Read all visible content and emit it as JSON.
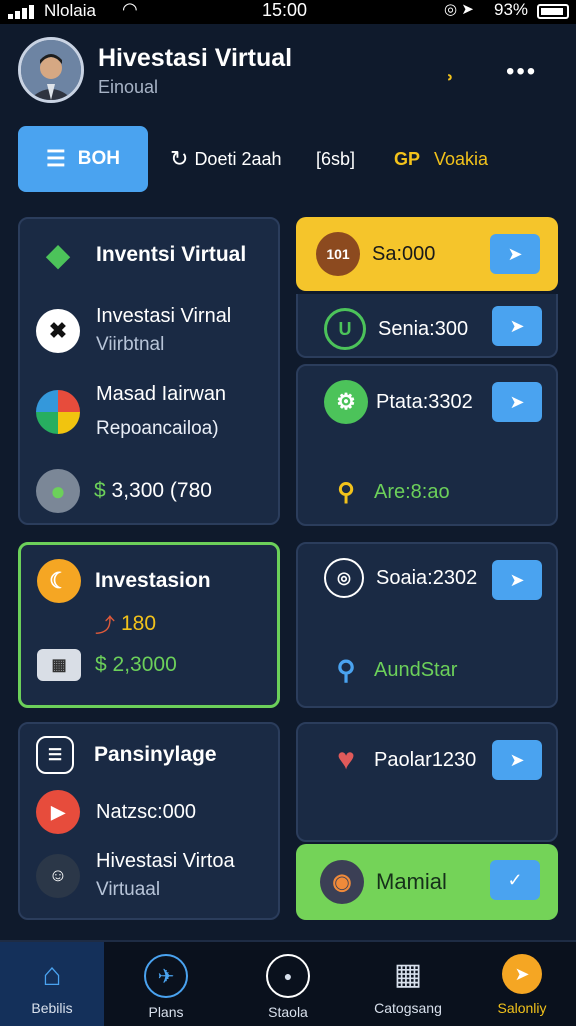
{
  "status_bar": {
    "carrier": "Nlolaia",
    "time": "15:00",
    "battery": "93%"
  },
  "header": {
    "title": "Hivestasi Virtual",
    "subtitle": "Einoual"
  },
  "tabs": [
    {
      "label": "BOH"
    },
    {
      "label": "Doeti 2aah"
    },
    {
      "label": "[6sb]"
    },
    {
      "label": "Voakia"
    }
  ],
  "left_card_1": {
    "title": "Inventsi Virtual",
    "item1_title": "Investasi Virnal",
    "item1_sub": "Viirbtnal",
    "item2_title": "Masad Iairwan",
    "item2_sub": "Repoancailoa)",
    "amount": "3,300 (780"
  },
  "left_card_2": {
    "title": "Investasion",
    "value": "180",
    "amount": "2,3000"
  },
  "left_card_3": {
    "title": "Pansinylage",
    "item1_title": "Natzsc:000",
    "item2_title": "Hivestasi Virtoa",
    "item2_sub": "Virtuaal"
  },
  "right_items": [
    {
      "label": "Sa:000",
      "icon_text": "101"
    },
    {
      "label": "Senia:300"
    },
    {
      "label": "Ptata:3302"
    },
    {
      "label": "Are:8:ao"
    },
    {
      "label": "Soaia:2302"
    },
    {
      "label": "AundStar"
    },
    {
      "label": "Paolar1230"
    },
    {
      "label": "Mamial"
    }
  ],
  "bottom_nav": [
    {
      "label": "Bebilis"
    },
    {
      "label": "Plans"
    },
    {
      "label": "Staola"
    },
    {
      "label": "Catogsang"
    },
    {
      "label": "Salonliy"
    }
  ],
  "colors": {
    "accent": "#4aa3f0",
    "green": "#6cd05a",
    "gold": "#f2c21b",
    "background": "#0f1a2c"
  }
}
